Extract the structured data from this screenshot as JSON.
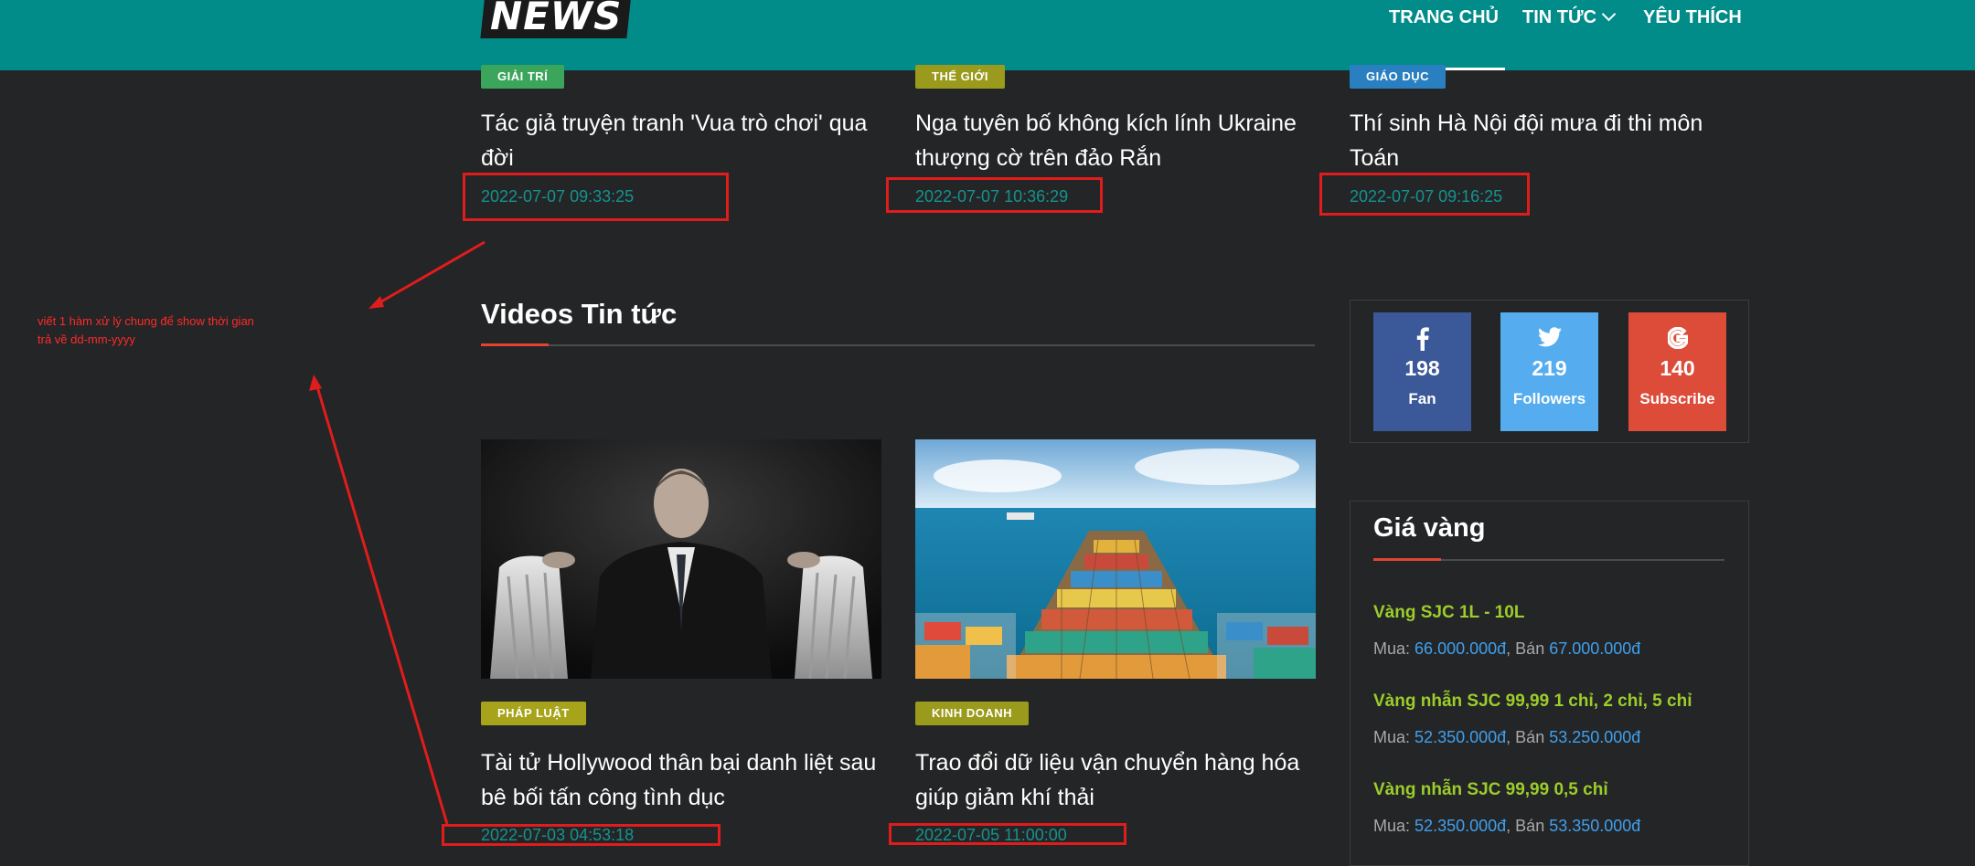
{
  "header": {
    "logo_text": "NEWS",
    "nav": {
      "home": "TRANG CHỦ",
      "news": "TIN TỨC",
      "favorites": "YÊU THÍCH"
    }
  },
  "top_articles": [
    {
      "category": "GIẢI TRÍ",
      "category_color": "#3ca55c",
      "title": "Tác giả truyện tranh 'Vua trò chơi' qua đời",
      "date": "2022-07-07 09:33:25"
    },
    {
      "category": "THẾ GIỚI",
      "category_color": "#9a9a1c",
      "title": "Nga tuyên bố không kích lính Ukraine thượng cờ trên đảo Rắn",
      "date": "2022-07-07 10:36:29"
    },
    {
      "category": "GIÁO DỤC",
      "category_color": "#2a7fc1",
      "title": "Thí sinh Hà Nội đội mưa đi thi môn Toán",
      "date": "2022-07-07 09:16:25"
    }
  ],
  "videos_section": {
    "title": "Videos Tin tức",
    "articles": [
      {
        "category": "PHÁP LUẬT",
        "category_color": "#a7a41c",
        "title": "Tài tử Hollywood thân bại danh liệt sau bê bối tấn công tình dục",
        "date": "2022-07-03 04:53:18"
      },
      {
        "category": "KINH DOANH",
        "category_color": "#9a9a1c",
        "title": "Trao đổi dữ liệu vận chuyển hàng hóa giúp giảm khí thải",
        "date": "2022-07-05 11:00:00"
      }
    ]
  },
  "annotation": {
    "line1": "viết 1 hàm xử lý chung để show thời gian",
    "line2": "trả về dd-mm-yyyy",
    "color": "#e11c1c"
  },
  "social": [
    {
      "icon": "facebook-icon",
      "count": "198",
      "label": "Fan",
      "color": "#3b5998"
    },
    {
      "icon": "twitter-icon",
      "count": "219",
      "label": "Followers",
      "color": "#55acee"
    },
    {
      "icon": "google-icon",
      "count": "140",
      "label": "Subscribe",
      "color": "#dd4b39"
    }
  ],
  "gold": {
    "title": "Giá vàng",
    "buy_label": "Mua:",
    "sell_label": "Bán",
    "items": [
      {
        "name": "Vàng SJC 1L - 10L",
        "buy": "66.000.000đ",
        "sell": "67.000.000đ"
      },
      {
        "name": "Vàng nhẫn SJC 99,99 1 chỉ, 2 chỉ, 5 chỉ",
        "buy": "52.350.000đ",
        "sell": "53.250.000đ"
      },
      {
        "name": "Vàng nhẫn SJC 99,99 0,5 chỉ",
        "buy": "52.350.000đ",
        "sell": "53.350.000đ"
      }
    ]
  },
  "colors": {
    "header_bg": "#018b89",
    "page_bg": "#242526",
    "date_text": "#14938f",
    "gold_name": "#9ccd2b",
    "price_value": "#3fa0ef",
    "accent": "#e1452e"
  }
}
